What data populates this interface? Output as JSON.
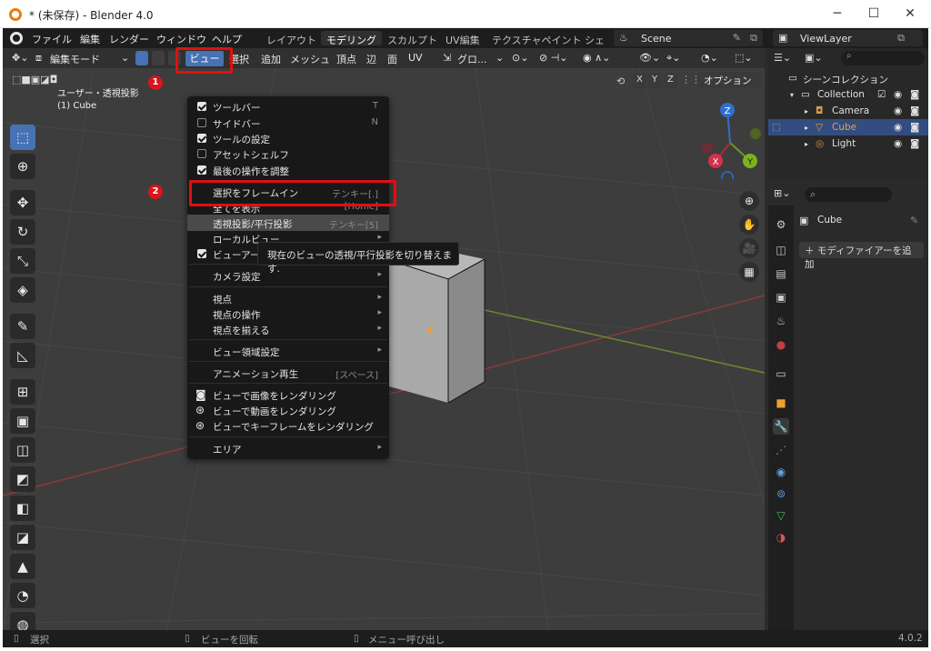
{
  "window": {
    "title": "* (未保存) - Blender 4.0",
    "min": "─",
    "max": "☐",
    "close": "✕"
  },
  "topbar": {
    "menus": [
      "ファイル",
      "編集",
      "レンダー",
      "ウィンドウ",
      "ヘルプ"
    ],
    "workspaces": [
      "レイアウト",
      "モデリング",
      "スカルプト",
      "UV編集",
      "テクスチャペイント",
      "シェ"
    ],
    "active_workspace": "モデリング",
    "scene": "Scene",
    "view_layer": "ViewLayer"
  },
  "viewport_header": {
    "mode": "編集モード",
    "view_menu": "ビュー",
    "menus": [
      "選択",
      "追加",
      "メッシュ",
      "頂点",
      "辺",
      "面",
      "UV"
    ],
    "transform": "グロ...",
    "options": "オプション"
  },
  "viewport": {
    "view_name": "ユーザー・透視投影",
    "object_name": "(1) Cube",
    "axes": [
      "X",
      "Y",
      "Z"
    ],
    "gizmo": {
      "x": "X",
      "y": "Y",
      "z": "Z"
    }
  },
  "view_menu": {
    "items": [
      {
        "label": "ツールバー",
        "shortcut": "T",
        "check": "on"
      },
      {
        "label": "サイドバー",
        "shortcut": "N",
        "check": "off"
      },
      {
        "label": "ツールの設定",
        "shortcut": "",
        "check": "on"
      },
      {
        "label": "アセットシェルフ",
        "shortcut": "",
        "check": "off"
      },
      {
        "label": "最後の操作を調整",
        "shortcut": "",
        "check": "on"
      },
      {
        "label": "選択をフレームイン",
        "shortcut": "テンキー[.]"
      },
      {
        "label": "全てを表示",
        "shortcut": "[Home]"
      },
      {
        "label": "透視投影/平行投影",
        "shortcut": "テンキー[5]"
      },
      {
        "label": "ローカルビュー",
        "shortcut": ""
      },
      {
        "label": "ビューアー",
        "shortcut": "",
        "check": "on"
      },
      {
        "label": "カメラ設定",
        "submenu": true
      },
      {
        "label": "視点",
        "submenu": true
      },
      {
        "label": "視点の操作",
        "submenu": true
      },
      {
        "label": "視点を揃える",
        "submenu": true
      },
      {
        "label": "ビュー領域設定",
        "submenu": true
      },
      {
        "label": "アニメーション再生",
        "shortcut": "[スペース]"
      },
      {
        "label": "ビューで画像をレンダリング",
        "icon": "camera"
      },
      {
        "label": "ビューで動画をレンダリング",
        "icon": "film"
      },
      {
        "label": "ビューでキーフレームをレンダリング",
        "icon": "film"
      },
      {
        "label": "エリア",
        "submenu": true
      }
    ]
  },
  "tooltip": "現在のビューの透視/平行投影を切り替えます.",
  "annotations": {
    "step1": "1",
    "step2": "2"
  },
  "outliner": {
    "title": "シーンコレクション",
    "collection": "Collection",
    "objects": [
      "Camera",
      "Cube",
      "Light"
    ],
    "selected": "Cube"
  },
  "properties": {
    "object_name": "Cube",
    "add_modifier": "モディファイアーを追加"
  },
  "statusbar": {
    "select": "選択",
    "rotate": "ビューを回転",
    "menu": "メニュー呼び出し",
    "version": "4.0.2"
  },
  "colors": {
    "accent": "#4772b3",
    "highlight_red": "#e01010",
    "selected_orange": "#f0a030"
  }
}
